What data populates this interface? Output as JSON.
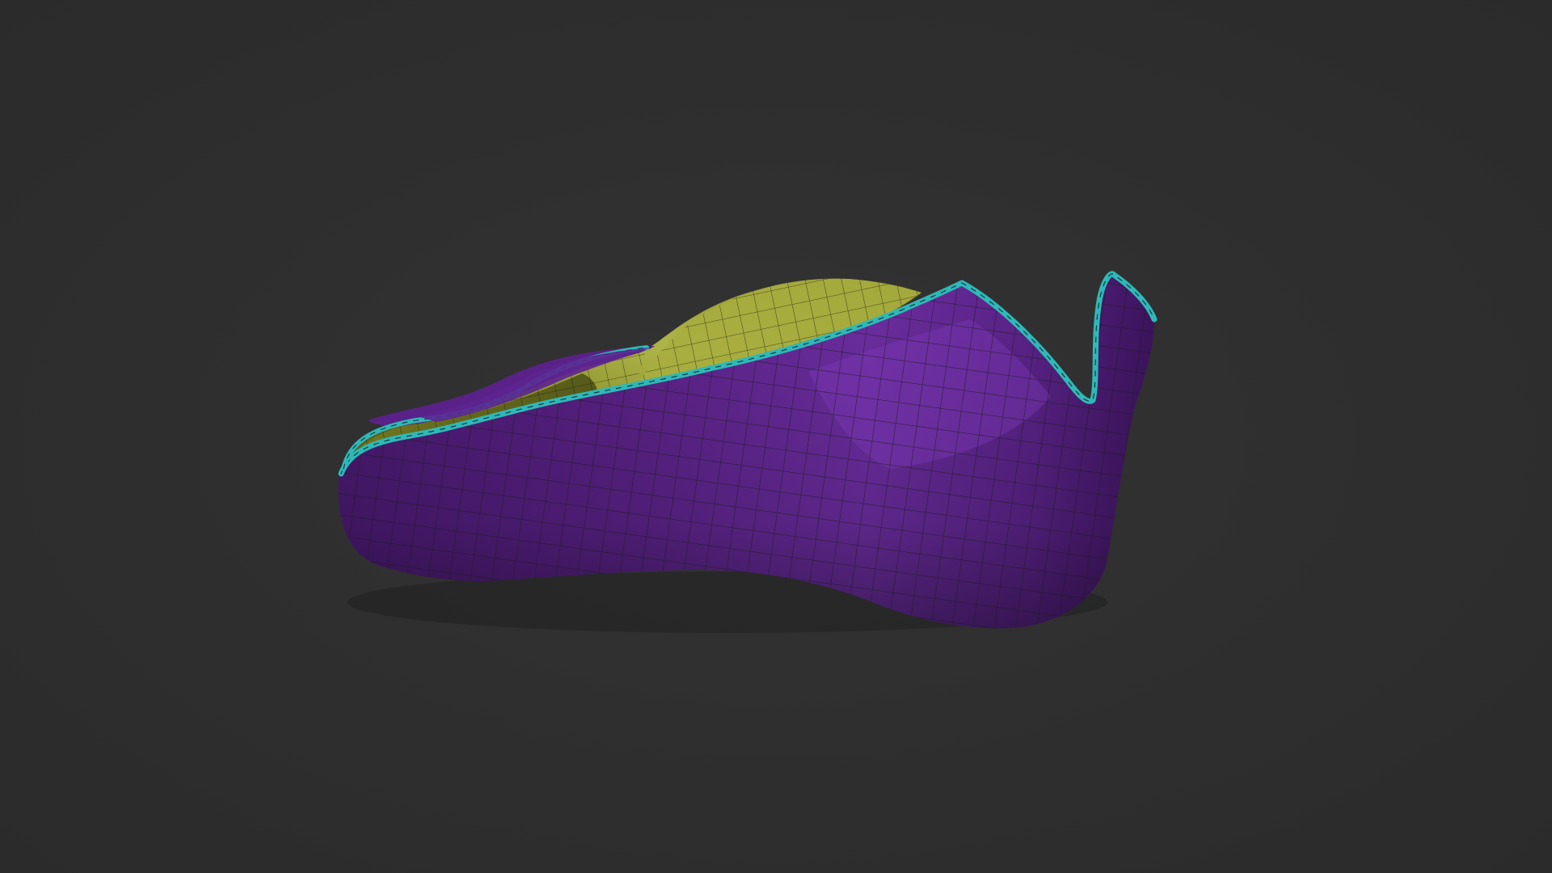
{
  "viewport": {
    "background": "#2f2f2f"
  },
  "model": {
    "kind": "hat-mesh-polygroups",
    "polygroup_colors": {
      "outer_shell": "#6a2a9a",
      "inner_shell": "#9aa034",
      "rim_border": "#2fb8b8",
      "wireframe": "#1a1a1a"
    }
  }
}
